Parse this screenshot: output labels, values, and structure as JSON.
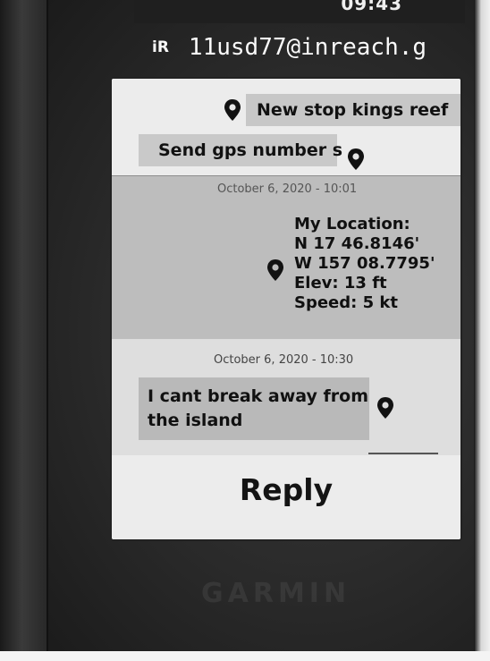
{
  "status": {
    "time": "09:43"
  },
  "header": {
    "app_badge": "iR",
    "address": "11usd77@inreach.g"
  },
  "conversation": {
    "messages": [
      {
        "text": "New stop kings reef",
        "direction": "incoming"
      },
      {
        "text": "Send gps number s",
        "direction": "outgoing"
      }
    ],
    "location_message": {
      "timestamp": "October 6, 2020 - 10:01",
      "lines": [
        "My Location:",
        "N 17 46.8146'",
        "W 157 08.7795'",
        "Elev: 13 ft",
        "Speed: 5 kt"
      ]
    },
    "last_message": {
      "timestamp": "October 6, 2020 - 10:30",
      "text": "I cant break away from the island"
    }
  },
  "actions": {
    "reply_label": "Reply"
  },
  "device": {
    "brand": "GARMIN"
  },
  "icons": {
    "pin": "map-pin-icon"
  },
  "colors": {
    "screen_background": "#d9d9d9",
    "bubble_gray": "#c7c7c7",
    "location_block": "#bdbdbd",
    "header_text": "#fafafa"
  }
}
